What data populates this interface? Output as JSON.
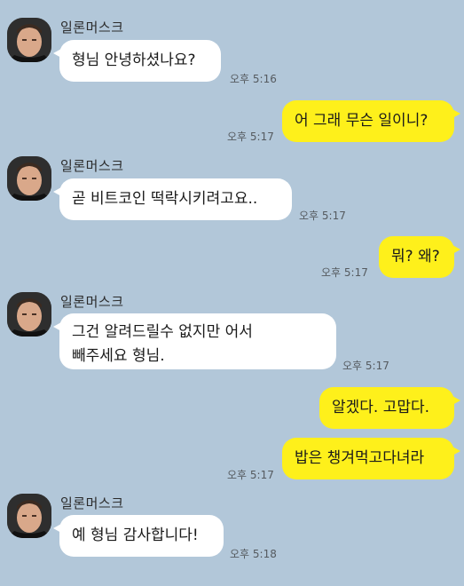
{
  "sender_name": "일론머스크",
  "messages": [
    {
      "direction": "in",
      "text": "형님 안녕하셨나요?",
      "time": "오후 5:16"
    },
    {
      "direction": "out",
      "text": "어 그래 무슨 일이니?",
      "time": "오후 5:17"
    },
    {
      "direction": "in",
      "text": "곧 비트코인 떡락시키려고요..",
      "time": "오후 5:17"
    },
    {
      "direction": "out",
      "text": "뭐? 왜?",
      "time": "오후 5:17"
    },
    {
      "direction": "in",
      "text_lines": [
        "그건 알려드릴수 없지만 어서",
        "빼주세요 형님."
      ],
      "time": "오후 5:17"
    },
    {
      "direction": "out",
      "text": "알겠다. 고맙다.",
      "time": ""
    },
    {
      "direction": "out",
      "text": "밥은 챙겨먹고다녀라",
      "time": "오후 5:17"
    },
    {
      "direction": "in",
      "text": "예 형님 감사합니다!",
      "time": "오후 5:18"
    }
  ]
}
